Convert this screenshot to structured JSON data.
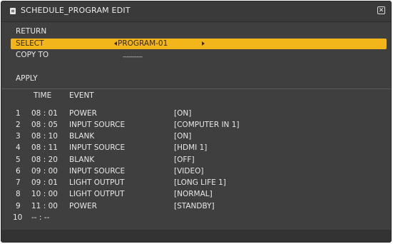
{
  "window": {
    "title": "SCHEDULE_PROGRAM EDIT",
    "close_glyph": "✕"
  },
  "menu": {
    "return_label": "RETURN",
    "select_label": "SELECT",
    "select_value": "PROGRAM-01",
    "copy_to_label": "COPY TO",
    "copy_to_value": "----------",
    "apply_label": "APPLY"
  },
  "schedule": {
    "headers": {
      "time": "TIME",
      "event": "EVENT"
    },
    "rows": [
      {
        "num": "1",
        "time": "08 : 01",
        "event": "POWER",
        "value": "[ON]"
      },
      {
        "num": "2",
        "time": "08 : 05",
        "event": "INPUT SOURCE",
        "value": "[COMPUTER IN 1]"
      },
      {
        "num": "3",
        "time": "08 : 10",
        "event": "BLANK",
        "value": "[ON]"
      },
      {
        "num": "4",
        "time": "08 : 11",
        "event": "INPUT SOURCE",
        "value": "[HDMI 1]"
      },
      {
        "num": "5",
        "time": "08 : 20",
        "event": "BLANK",
        "value": "[OFF]"
      },
      {
        "num": "6",
        "time": "09 : 00",
        "event": "INPUT SOURCE",
        "value": "[VIDEO]"
      },
      {
        "num": "7",
        "time": "09 : 01",
        "event": "LIGHT OUTPUT",
        "value": "[LONG LIFE 1]"
      },
      {
        "num": "8",
        "time": "10 : 00",
        "event": "LIGHT OUTPUT",
        "value": "[NORMAL]"
      },
      {
        "num": "9",
        "time": "11 : 00",
        "event": "POWER",
        "value": "[STANDBY]"
      },
      {
        "num": "10",
        "time": "-- : --",
        "event": "",
        "value": ""
      }
    ]
  },
  "colors": {
    "highlight": "#f2b51a",
    "background": "#3f3f3f"
  }
}
